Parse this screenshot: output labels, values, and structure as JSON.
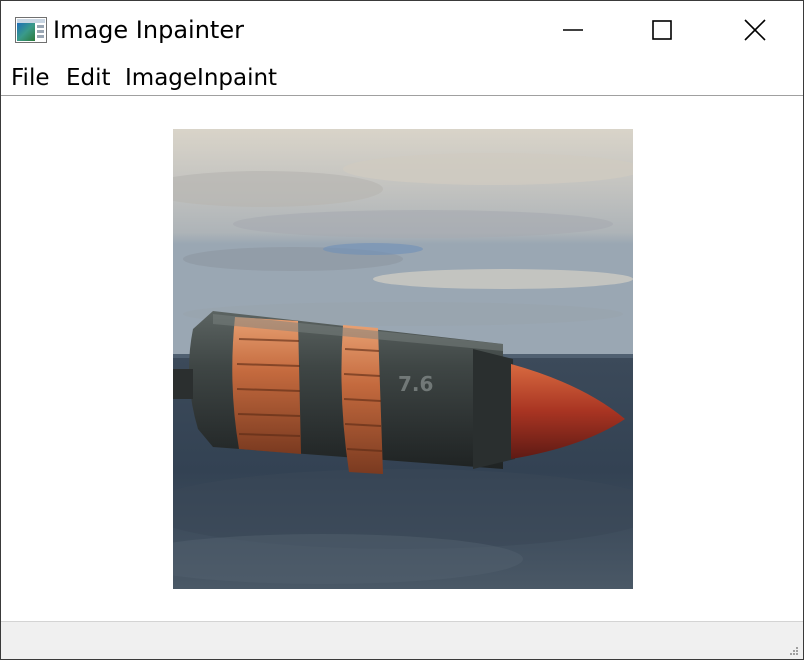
{
  "window": {
    "title": "Image Inpainter",
    "controls": {
      "minimize_icon": "minimize-icon",
      "maximize_icon": "maximize-icon",
      "close_icon": "close-icon"
    }
  },
  "menubar": {
    "items": [
      {
        "label": "File"
      },
      {
        "label": "Edit"
      },
      {
        "label": "ImageInpaint"
      }
    ]
  },
  "canvas": {
    "image_content": "bullet-projectile-over-sea-image"
  },
  "statusbar": {
    "text": ""
  },
  "colors": {
    "window_bg": "#ffffff",
    "statusbar_bg": "#f0f0f0",
    "border": "#3a3a3a",
    "menu_divider": "#a0a0a0"
  }
}
